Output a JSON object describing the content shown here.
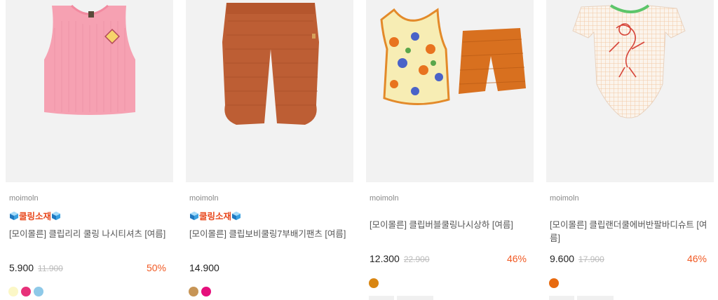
{
  "products": [
    {
      "brand": "moimoln",
      "badge": "쿨링소재",
      "title": "[모이몰른] 클립리리 쿨링 나시티셔츠 [여름]",
      "price": "5.900",
      "original_price": "11.900",
      "discount": "50%",
      "swatches": [
        "#fbf7c6",
        "#e7317a",
        "#8ec9e8"
      ]
    },
    {
      "brand": "moimoln",
      "badge": "쿨링소재",
      "title": "[모이몰른] 클립보비쿨링7부배기팬츠 [여름]",
      "price": "14.900",
      "original_price": "",
      "discount": "",
      "swatches": [
        "#c79556",
        "#e50f7c"
      ]
    },
    {
      "brand": "moimoln",
      "badge": "",
      "title": "[모이몰른] 클립버블쿨링나시상하 [여름]",
      "price": "12.300",
      "original_price": "22.900",
      "discount": "46%",
      "swatches": [
        "#d98612"
      ]
    },
    {
      "brand": "moimoln",
      "badge": "",
      "title": "[모이몰른] 클립랜더쿨에버반팔바디슈트 [여름]",
      "price": "9.600",
      "original_price": "17.900",
      "discount": "46%",
      "swatches": [
        "#e86a0f"
      ]
    }
  ]
}
